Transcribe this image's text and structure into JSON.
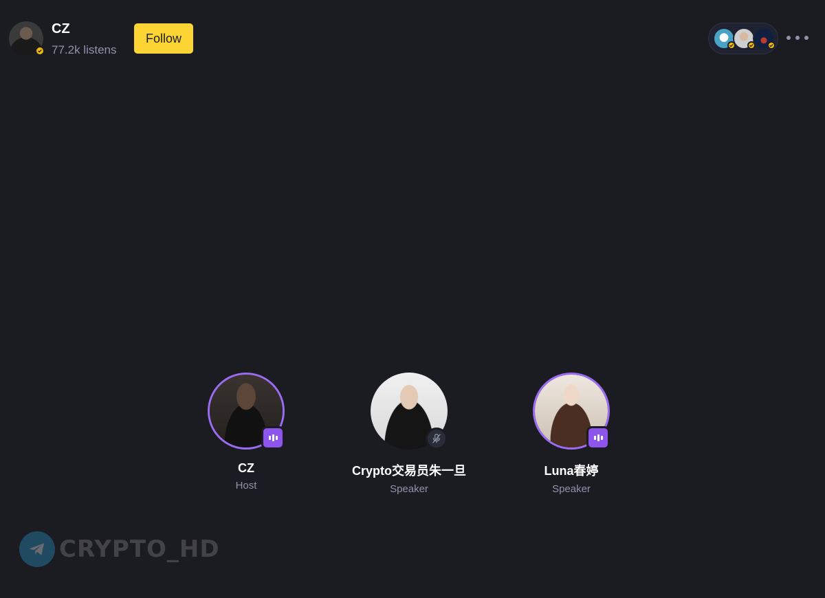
{
  "header": {
    "host_name": "CZ",
    "listens": "77.2k listens",
    "follow_label": "Follow",
    "listener_avatar_count": 3
  },
  "speakers": [
    {
      "name": "CZ",
      "role": "Host",
      "status": "speaking"
    },
    {
      "name": "Crypto交易员朱一旦",
      "role": "Speaker",
      "status": "muted"
    },
    {
      "name": "Luna春婷",
      "role": "Speaker",
      "status": "speaking"
    }
  ],
  "watermark": {
    "text": "CRYPTO_HD"
  },
  "colors": {
    "background": "#1b1b22",
    "accent_yellow": "#fcd535",
    "speaking_purple": "#8d55ec",
    "muted_text": "#8e95a8",
    "verified_gold": "#f0b90b"
  },
  "icons": [
    "verified-badge-icon",
    "more-icon",
    "sound-wave-icon",
    "mic-off-icon",
    "telegram-icon"
  ]
}
